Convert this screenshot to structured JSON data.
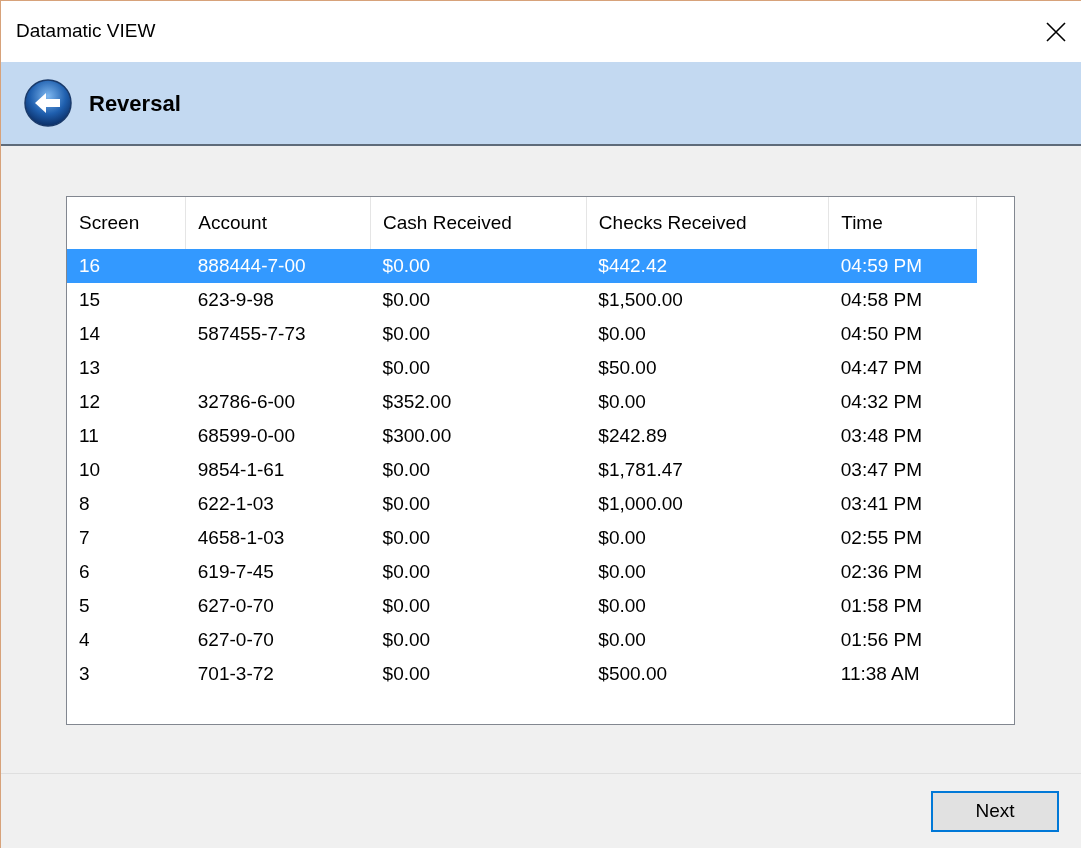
{
  "window": {
    "title": "Datamatic VIEW"
  },
  "header": {
    "title": "Reversal"
  },
  "table": {
    "columns": [
      "Screen",
      "Account",
      "Cash Received",
      "Checks Received",
      "Time"
    ],
    "rows": [
      {
        "screen": "16",
        "account": "888444-7-00",
        "cash": "$0.00",
        "checks": "$442.42",
        "time": "04:59 PM",
        "selected": true
      },
      {
        "screen": "15",
        "account": "623-9-98",
        "cash": "$0.00",
        "checks": "$1,500.00",
        "time": "04:58 PM",
        "selected": false
      },
      {
        "screen": "14",
        "account": "587455-7-73",
        "cash": "$0.00",
        "checks": "$0.00",
        "time": "04:50 PM",
        "selected": false
      },
      {
        "screen": "13",
        "cash": "$0.00",
        "checks": "$50.00",
        "time": "04:47 PM",
        "selected": false
      },
      {
        "screen": "12",
        "account": "32786-6-00",
        "cash": "$352.00",
        "checks": "$0.00",
        "time": "04:32 PM",
        "selected": false
      },
      {
        "screen": "11",
        "account": "68599-0-00",
        "cash": "$300.00",
        "checks": "$242.89",
        "time": "03:48 PM",
        "selected": false
      },
      {
        "screen": "10",
        "account": "9854-1-61",
        "cash": "$0.00",
        "checks": "$1,781.47",
        "time": "03:47 PM",
        "selected": false
      },
      {
        "screen": "8",
        "account": "622-1-03",
        "cash": "$0.00",
        "checks": "$1,000.00",
        "time": "03:41 PM",
        "selected": false
      },
      {
        "screen": "7",
        "account": "4658-1-03",
        "cash": "$0.00",
        "checks": "$0.00",
        "time": "02:55 PM",
        "selected": false
      },
      {
        "screen": "6",
        "account": "619-7-45",
        "cash": "$0.00",
        "checks": "$0.00",
        "time": "02:36 PM",
        "selected": false
      },
      {
        "screen": "5",
        "account": "627-0-70",
        "cash": "$0.00",
        "checks": "$0.00",
        "time": "01:58 PM",
        "selected": false
      },
      {
        "screen": "4",
        "account": "627-0-70",
        "cash": "$0.00",
        "checks": "$0.00",
        "time": "01:56 PM",
        "selected": false
      },
      {
        "screen": "3",
        "account": "701-3-72",
        "cash": "$0.00",
        "checks": "$500.00",
        "time": "11:38 AM",
        "selected": false
      }
    ]
  },
  "buttons": [
    "Next"
  ]
}
